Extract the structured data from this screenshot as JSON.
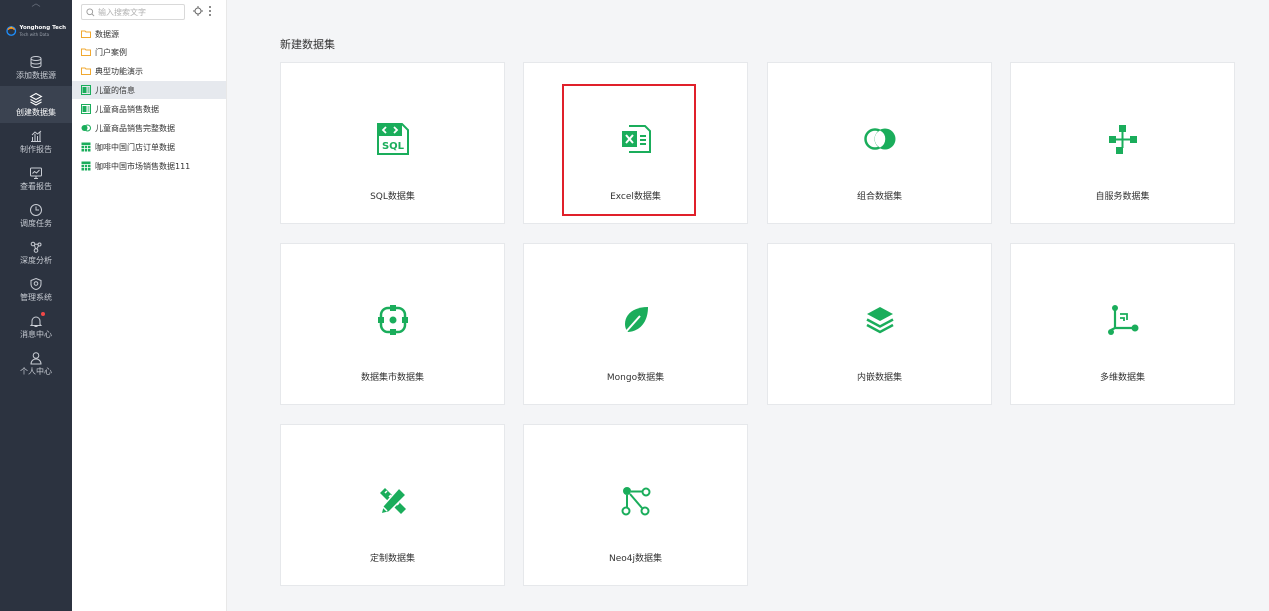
{
  "colors": {
    "accent": "#1aad5b",
    "nav_bg": "#2c3340",
    "highlight": "#e0202a"
  },
  "nav": {
    "logo": {
      "name": "Yonghong Tech",
      "slogan": "Tech with Data"
    },
    "items": [
      {
        "label": "添加数据源",
        "icon": "database-icon"
      },
      {
        "label": "创建数据集",
        "icon": "layers-icon"
      },
      {
        "label": "制作报告",
        "icon": "chart-icon"
      },
      {
        "label": "查看报告",
        "icon": "monitor-icon"
      },
      {
        "label": "调度任务",
        "icon": "clock-icon"
      },
      {
        "label": "深度分析",
        "icon": "nodes-icon"
      },
      {
        "label": "管理系统",
        "icon": "shield-icon"
      },
      {
        "label": "消息中心",
        "icon": "bell-icon"
      },
      {
        "label": "个人中心",
        "icon": "user-icon"
      }
    ]
  },
  "tree": {
    "search_placeholder": "输入搜索文字",
    "items": [
      {
        "label": "数据源",
        "icon": "folder-icon"
      },
      {
        "label": "门户案例",
        "icon": "folder-icon"
      },
      {
        "label": "典型功能演示",
        "icon": "folder-icon"
      },
      {
        "label": "儿童的信息",
        "icon": "excel-file-icon"
      },
      {
        "label": "儿童商品销售数据",
        "icon": "excel-file-icon"
      },
      {
        "label": "儿童商品销售完整数据",
        "icon": "combine-icon"
      },
      {
        "label": "咖啡中国门店订单数据",
        "icon": "table-icon"
      },
      {
        "label": "咖啡中国市场销售数据111",
        "icon": "table-icon"
      }
    ]
  },
  "main": {
    "title": "新建数据集",
    "cards": [
      {
        "label": "SQL数据集",
        "icon": "sql-icon"
      },
      {
        "label": "Excel数据集",
        "icon": "excel-icon"
      },
      {
        "label": "组合数据集",
        "icon": "combine-circles-icon"
      },
      {
        "label": "自服务数据集",
        "icon": "flow-icon"
      },
      {
        "label": "数据集市数据集",
        "icon": "target-icon"
      },
      {
        "label": "Mongo数据集",
        "icon": "leaf-icon"
      },
      {
        "label": "内嵌数据集",
        "icon": "layers-stack-icon"
      },
      {
        "label": "多维数据集",
        "icon": "cube-axis-icon"
      },
      {
        "label": "定制数据集",
        "icon": "pencil-ruler-icon"
      },
      {
        "label": "Neo4j数据集",
        "icon": "graph-icon"
      }
    ]
  }
}
